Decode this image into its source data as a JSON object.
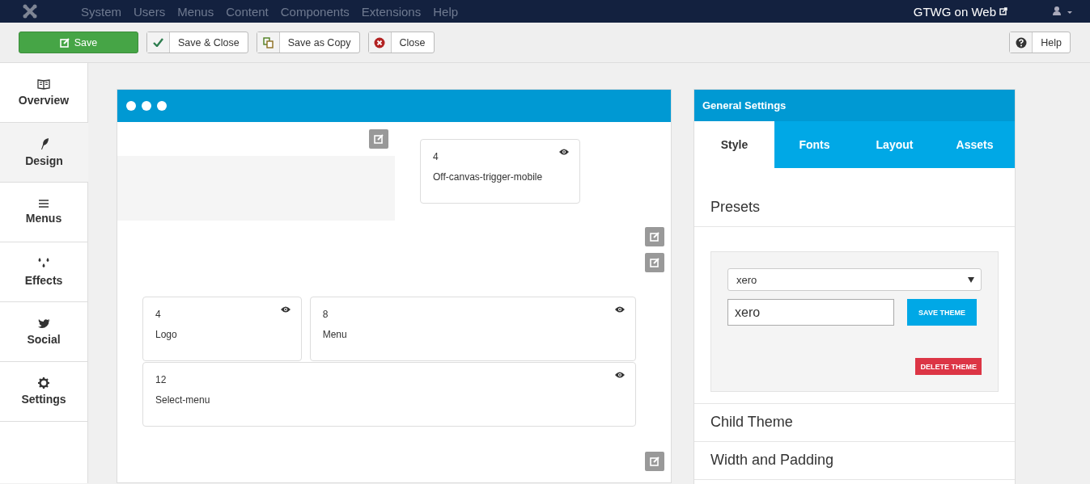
{
  "nav": {
    "menu": [
      "System",
      "Users",
      "Menus",
      "Content",
      "Components",
      "Extensions",
      "Help"
    ],
    "site_link": "GTWG on Web"
  },
  "toolbar": {
    "buttons": [
      {
        "label": "Save",
        "kind": "save"
      },
      {
        "label": "Save & Close",
        "kind": "check"
      },
      {
        "label": "Save as Copy",
        "kind": "copy"
      },
      {
        "label": "Close",
        "kind": "close"
      }
    ],
    "help": {
      "label": "Help",
      "kind": "help"
    }
  },
  "sidebar": {
    "items": [
      {
        "label": "Overview",
        "kind": "book",
        "selected": false
      },
      {
        "label": "Design",
        "kind": "feather",
        "selected": true
      },
      {
        "label": "Menus",
        "kind": "bars",
        "selected": false
      },
      {
        "label": "Effects",
        "kind": "drops",
        "selected": false
      },
      {
        "label": "Social",
        "kind": "bird",
        "selected": false
      },
      {
        "label": "Settings",
        "kind": "gear",
        "selected": false
      }
    ]
  },
  "canvas": {
    "top_module": {
      "size": "4",
      "name": "Off-canvas-trigger-mobile"
    },
    "modules": [
      {
        "size": "4",
        "name": "Logo"
      },
      {
        "size": "8",
        "name": "Menu"
      },
      {
        "size": "12",
        "name": "Select-menu"
      }
    ]
  },
  "settings": {
    "title": "General Settings",
    "tabs": [
      {
        "label": "Style",
        "selected": true
      },
      {
        "label": "Fonts",
        "selected": false
      },
      {
        "label": "Layout",
        "selected": false
      },
      {
        "label": "Assets",
        "selected": false
      }
    ],
    "presets": {
      "heading": "Presets",
      "select_value": "xero",
      "name_value": "xero",
      "save_button": "SAVE THEME",
      "delete_button": "DELETE THEME"
    },
    "sections": [
      "Child Theme",
      "Width and Padding"
    ]
  }
}
